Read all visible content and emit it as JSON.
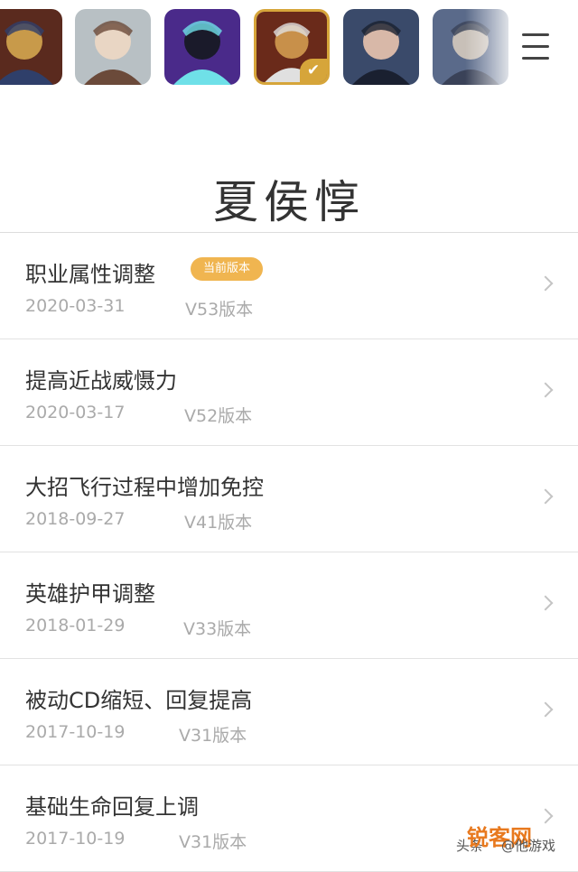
{
  "heroes": [
    {
      "name": "hero-1",
      "selected": false,
      "palette": [
        "#5a2a1e",
        "#c89a4a",
        "#2f3f6a"
      ]
    },
    {
      "name": "hero-2",
      "selected": false,
      "palette": [
        "#b8c0c4",
        "#e9d6c4",
        "#6b4a3a"
      ]
    },
    {
      "name": "hero-3",
      "selected": false,
      "palette": [
        "#4a2a8a",
        "#1a1a2a",
        "#6fe0e8"
      ]
    },
    {
      "name": "hero-4",
      "selected": true,
      "palette": [
        "#6a2a1a",
        "#c8904a",
        "#e0e0e0"
      ]
    },
    {
      "name": "hero-5",
      "selected": false,
      "palette": [
        "#3a4a6a",
        "#d8b8a8",
        "#1a2030"
      ]
    },
    {
      "name": "hero-6",
      "selected": false,
      "palette": [
        "#5a6a8a",
        "#c8c0b8",
        "#3a4258"
      ]
    }
  ],
  "hero_name": "夏侯惇",
  "changes": [
    {
      "title": "职业属性调整",
      "badge": "当前版本",
      "date": "2020-03-31",
      "version": "V53版本"
    },
    {
      "title": "提高近战威慑力",
      "date": "2020-03-17",
      "version": "V52版本"
    },
    {
      "title": "大招飞行过程中增加免控",
      "date": "2018-09-27",
      "version": "V41版本"
    },
    {
      "title": "英雄护甲调整",
      "date": "2018-01-29",
      "version": "V33版本"
    },
    {
      "title": "被动CD缩短、回复提高",
      "date": "2017-10-19",
      "version": "V31版本"
    },
    {
      "title": "基础生命回复上调",
      "date": "2017-10-19",
      "version": "V31版本"
    }
  ],
  "watermark": {
    "source": "头条",
    "site": "锐客网",
    "account": "@他游戏"
  },
  "colors": {
    "accent": "#f0b550",
    "selected_border": "#d6a53a",
    "muted": "#aaaaaa"
  }
}
